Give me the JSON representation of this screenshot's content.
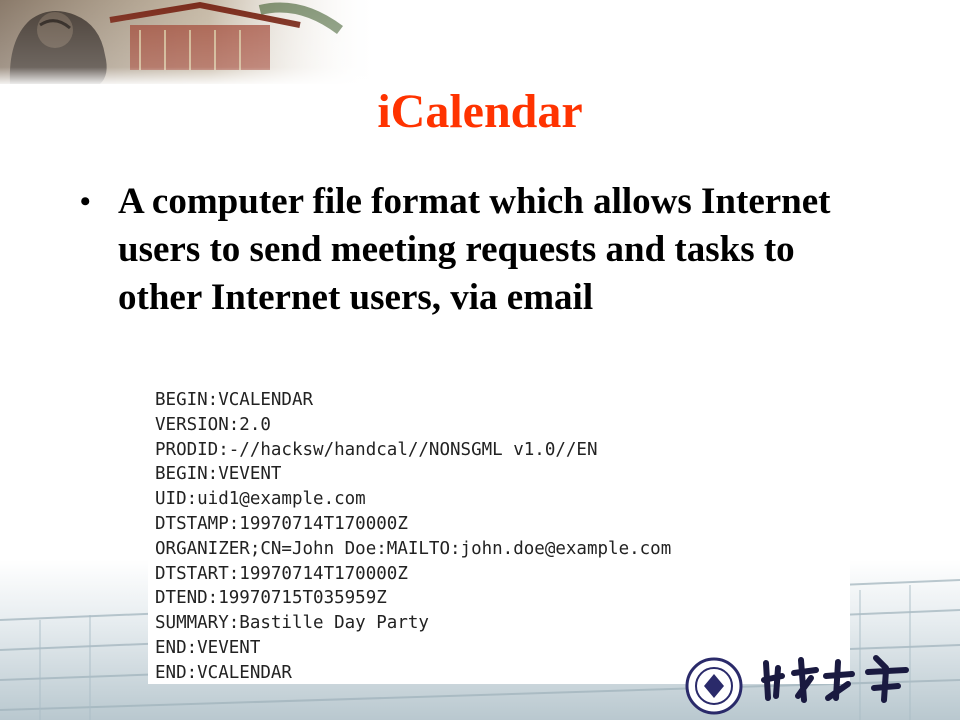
{
  "slide": {
    "title": "iCalendar",
    "bullet": {
      "marker": "•",
      "text": "A computer file format which allows Internet users to send meeting requests and tasks to other Internet users, via email"
    },
    "code_lines": [
      "BEGIN:VCALENDAR",
      "VERSION:2.0",
      "PRODID:-//hacksw/handcal//NONSGML v1.0//EN",
      "BEGIN:VEVENT",
      "UID:uid1@example.com",
      "DTSTAMP:19970714T170000Z",
      "ORGANIZER;CN=John Doe:MAILTO:john.doe@example.com",
      "DTSTART:19970714T170000Z",
      "DTEND:19970715T035959Z",
      "SUMMARY:Bastille Day Party",
      "END:VEVENT",
      "END:VCALENDAR"
    ],
    "logo_text": "北京大学"
  },
  "colors": {
    "title": "#ff3300",
    "text": "#000000",
    "code": "#222222"
  }
}
